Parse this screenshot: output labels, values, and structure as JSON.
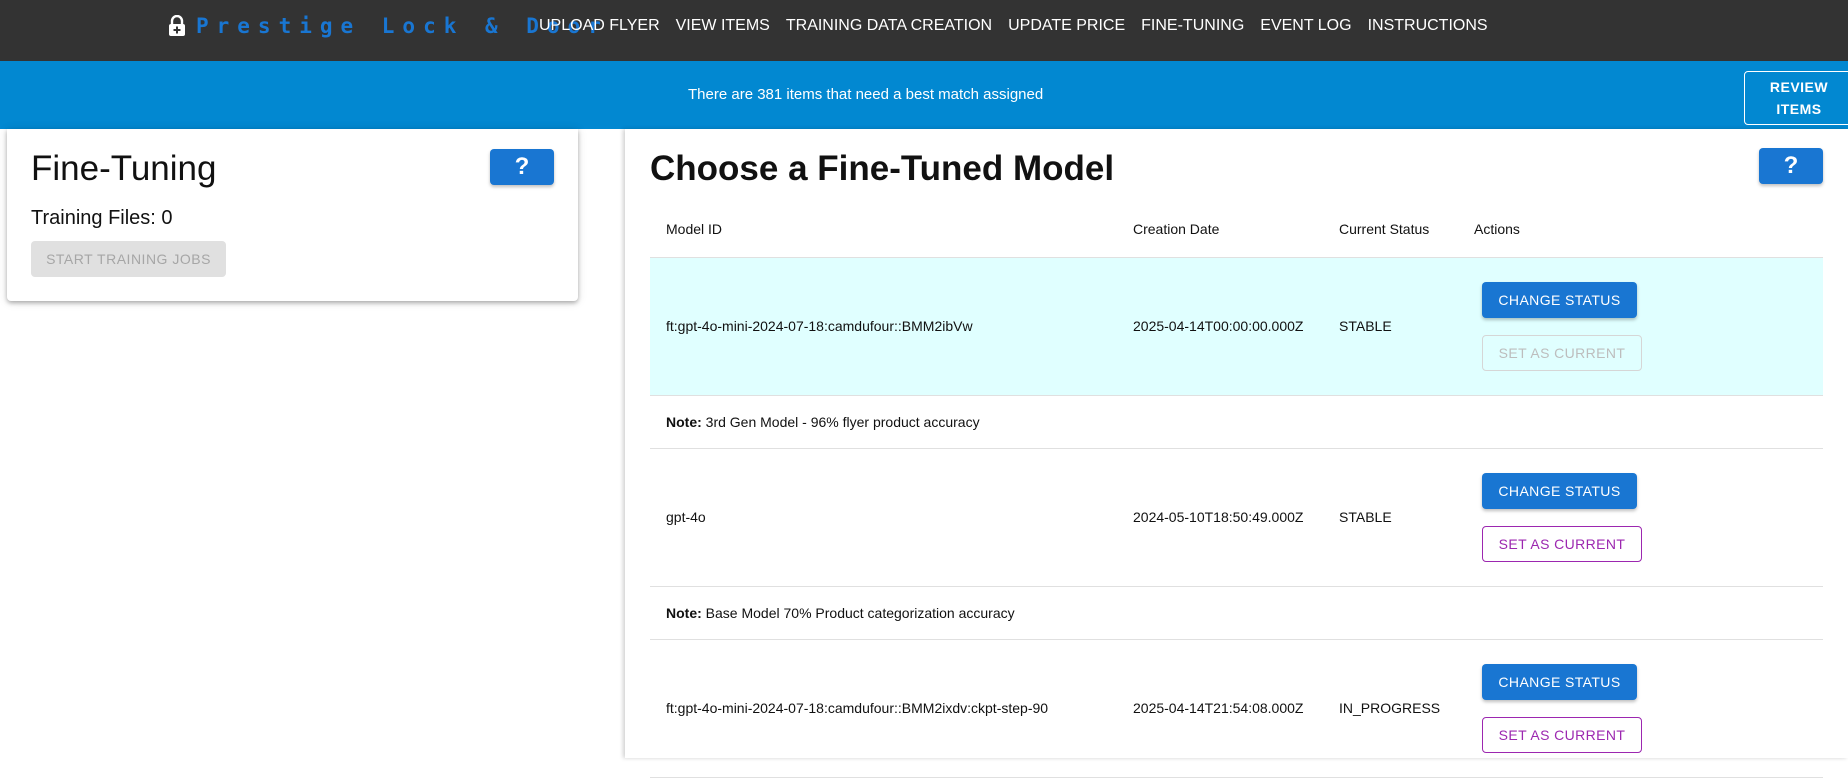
{
  "nav": {
    "brand": "Prestige Lock & Door",
    "links": [
      "UPLOAD FLYER",
      "VIEW ITEMS",
      "TRAINING DATA CREATION",
      "UPDATE PRICE",
      "FINE-TUNING",
      "EVENT LOG",
      "INSTRUCTIONS"
    ],
    "brand_color": "#1976d2",
    "bar_color": "#333333"
  },
  "banner": {
    "message": "There are 381 items that need a best match assigned",
    "button_line1": "REVIEW",
    "button_line2": "ITEMS",
    "color": "#0288d1"
  },
  "fine_tuning": {
    "title": "Fine-Tuning",
    "help_label": "?",
    "training_files": "Training Files: 0",
    "start_button": "START TRAINING JOBS"
  },
  "models": {
    "title": "Choose a Fine-Tuned Model",
    "help_label": "?",
    "columns": [
      "Model ID",
      "Creation Date",
      "Current Status",
      "Actions"
    ],
    "note_label": "Note:",
    "rows": [
      {
        "model_id": "ft:gpt-4o-mini-2024-07-18:camdufour::BMM2ibVw",
        "creation_date": "2025-04-14T00:00:00.000Z",
        "status": "STABLE",
        "change_label": "CHANGE STATUS",
        "set_label": "SET AS CURRENT",
        "is_current": true,
        "note": "3rd Gen Model - 96% flyer product accuracy"
      },
      {
        "model_id": "gpt-4o",
        "creation_date": "2024-05-10T18:50:49.000Z",
        "status": "STABLE",
        "change_label": "CHANGE STATUS",
        "set_label": "SET AS CURRENT",
        "is_current": false,
        "note": "Base Model 70% Product categorization accuracy"
      },
      {
        "model_id": "ft:gpt-4o-mini-2024-07-18:camdufour::BMM2ixdv:ckpt-step-90",
        "creation_date": "2025-04-14T21:54:08.000Z",
        "status": "IN_PROGRESS",
        "change_label": "CHANGE STATUS",
        "set_label": "SET AS CURRENT",
        "is_current": false
      }
    ]
  }
}
